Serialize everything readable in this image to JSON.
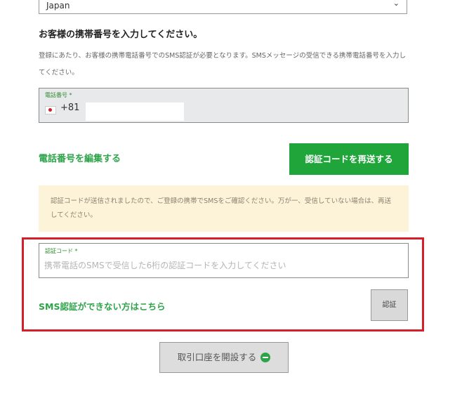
{
  "country": {
    "value": "Japan"
  },
  "sms_section": {
    "title": "お客様の携帯番号を入力してください。",
    "description": "登録にあたり、お客様の携帯電話番号でのSMS認証が必要となります。SMSメッセージの受信できる携帯電話番号を入力してください。"
  },
  "phone_field": {
    "label": "電話番号 *",
    "country_code": "+81"
  },
  "edit_phone_link": "電話番号を編集する",
  "resend_button": "認証コードを再送する",
  "notice": "認証コードが送信されましたので、ご登録の携帯でSMSをご確認ください。万が一、受信していない場合は、再送してください。",
  "code_field": {
    "label": "認証コード *",
    "placeholder": "携帯電話のSMSで受信した6桁の認証コードを入力してください"
  },
  "sms_help_link": "SMS認証ができない方はこちら",
  "verify_button": "認証",
  "open_account_button": "取引口座を開設する",
  "colors": {
    "accent_green": "#1fa539",
    "highlight_red": "#d3202a",
    "notice_bg": "#fdf3d9"
  }
}
